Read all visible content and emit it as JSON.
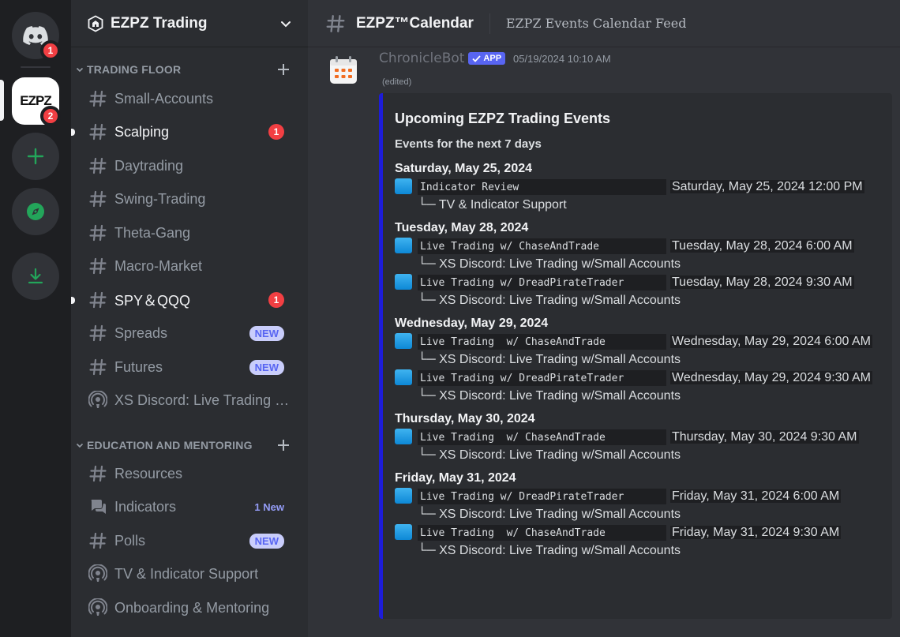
{
  "rail": {
    "home_badge": "1",
    "ezpz_badge": "2",
    "ezpz_logo_text": "EZPZ"
  },
  "guild": {
    "name": "EZPZ Trading"
  },
  "categories": {
    "trading_floor": "TRADING FLOOR",
    "education": "EDUCATION AND MENTORING"
  },
  "channels": [
    {
      "name": "Small-Accounts",
      "icon": "hash"
    },
    {
      "name": "Scalping",
      "icon": "hash",
      "unread": true,
      "badge": "1"
    },
    {
      "name": "Daytrading",
      "icon": "hash"
    },
    {
      "name": "Swing-Trading",
      "icon": "hash"
    },
    {
      "name": "Theta-Gang",
      "icon": "hash"
    },
    {
      "name": "Macro-Market",
      "icon": "hash"
    },
    {
      "name": "SPY＆QQQ",
      "icon": "hash",
      "unread": true,
      "badge": "1"
    },
    {
      "name": "Spreads",
      "icon": "hash",
      "pill": "NEW"
    },
    {
      "name": "Futures",
      "icon": "hash",
      "pill": "NEW"
    },
    {
      "name": "XS Discord: Live Trading w/Small Accounts",
      "icon": "stage"
    },
    {
      "name": "Resources",
      "icon": "hash"
    },
    {
      "name": "Indicators",
      "icon": "forum",
      "newtext": "1 New"
    },
    {
      "name": "Polls",
      "icon": "hash",
      "pill": "NEW"
    },
    {
      "name": "TV & Indicator Support",
      "icon": "stage"
    },
    {
      "name": "Onboarding & Mentoring",
      "icon": "stage"
    }
  ],
  "header": {
    "channel": "EZPZ™Calendar",
    "topic": "EZPZ Events Calendar Feed"
  },
  "message": {
    "author": "ChronicleBot",
    "app_tag": "APP",
    "timestamp": "05/19/2024 10:10 AM",
    "edited": "(edited)",
    "embed": {
      "title": "Upcoming EZPZ Trading Events",
      "subtitle": "Events for the next 7 days",
      "days": [
        {
          "label": "Saturday, May 25, 2024",
          "events": [
            {
              "name": "Indicator Review",
              "when": "Saturday, May 25, 2024 12:00 PM",
              "where": "└─ TV & Indicator Support"
            }
          ]
        },
        {
          "label": "Tuesday, May 28, 2024",
          "events": [
            {
              "name": "Live Trading w/ ChaseAndTrade",
              "when": "Tuesday, May 28, 2024 6:00 AM",
              "where": "└─ XS Discord: Live Trading w/Small Accounts"
            },
            {
              "name": "Live Trading w/ DreadPirateTrader",
              "when": "Tuesday, May 28, 2024 9:30 AM",
              "where": "└─ XS Discord: Live Trading w/Small Accounts"
            }
          ]
        },
        {
          "label": "Wednesday, May 29, 2024",
          "events": [
            {
              "name": "Live Trading  w/ ChaseAndTrade",
              "when": "Wednesday, May 29, 2024 6:00 AM",
              "where": "└─ XS Discord: Live Trading w/Small Accounts"
            },
            {
              "name": "Live Trading w/ DreadPirateTrader",
              "when": "Wednesday, May 29, 2024 9:30 AM",
              "where": "└─ XS Discord: Live Trading w/Small Accounts"
            }
          ]
        },
        {
          "label": "Thursday, May 30, 2024",
          "events": [
            {
              "name": "Live Trading  w/ ChaseAndTrade",
              "when": "Thursday, May 30, 2024 9:30 AM",
              "where": "└─ XS Discord: Live Trading w/Small Accounts"
            }
          ]
        },
        {
          "label": "Friday, May 31, 2024",
          "events": [
            {
              "name": "Live Trading w/ DreadPirateTrader",
              "when": "Friday, May 31, 2024 6:00 AM",
              "where": "└─ XS Discord: Live Trading w/Small Accounts"
            },
            {
              "name": "Live Trading  w/ ChaseAndTrade",
              "when": "Friday, May 31, 2024 9:30 AM",
              "where": "└─ XS Discord: Live Trading w/Small Accounts"
            }
          ]
        }
      ]
    }
  },
  "colors": {
    "accent": "#5865f2",
    "embed_bar": "#1d1cd9",
    "mention_red": "#f23f43",
    "green": "#23a55a"
  }
}
